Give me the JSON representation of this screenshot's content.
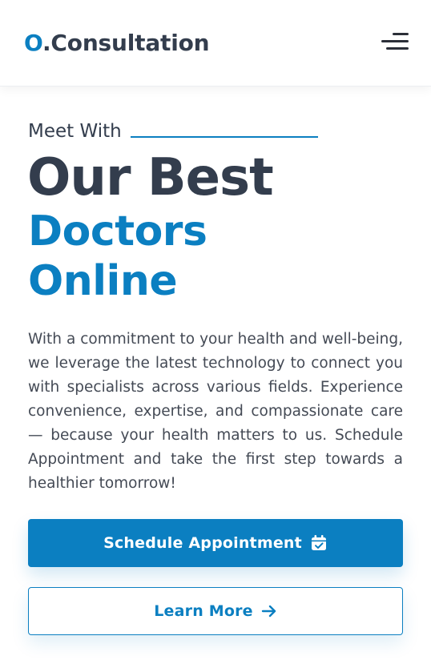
{
  "header": {
    "logo_mark": "O",
    "logo_text": ".Consultation"
  },
  "hero": {
    "eyebrow": "Meet With",
    "heading_line1": "Our Best",
    "heading_line2": "Doctors",
    "heading_line3": "Online",
    "description": "With a commitment to your health and well-being, we leverage the latest technology to connect you with specialists across various fields. Experience convenience, expertise, and compassionate care — because your health matters to us. Schedule Appointment and take the first step towards a healthier tomorrow!"
  },
  "actions": {
    "primary_label": "Schedule Appointment",
    "primary_icon": "calendar-check-icon",
    "secondary_label": "Learn More",
    "secondary_icon": "arrow-right-icon"
  },
  "colors": {
    "accent": "#0b7fc1",
    "heading_dark": "#333d4d",
    "body_text": "#444a55"
  }
}
